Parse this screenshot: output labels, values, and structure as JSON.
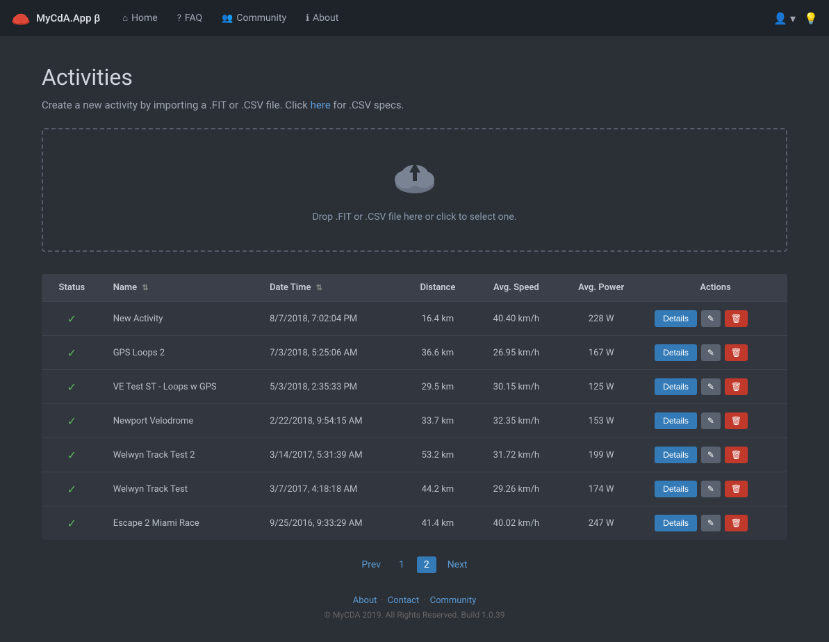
{
  "brand": {
    "name": "MyCdA.App β",
    "beta": "beta"
  },
  "nav": {
    "home": "Home",
    "faq": "FAQ",
    "community": "Community",
    "about": "About"
  },
  "page": {
    "title": "Activities",
    "subtitle_pre": "Create a new activity by importing a .FIT or .CSV file. Click",
    "subtitle_link": "here",
    "subtitle_post": "for .CSV specs."
  },
  "upload": {
    "prompt": "Drop .FIT or .CSV file here or click to select one."
  },
  "table": {
    "headers": [
      "Status",
      "Name",
      "Date Time",
      "Distance",
      "Avg. Speed",
      "Avg. Power",
      "Actions"
    ],
    "rows": [
      {
        "status": "✓",
        "name": "New Activity",
        "datetime": "8/7/2018, 7:02:04 PM",
        "distance": "16.4 km",
        "avg_speed": "40.40 km/h",
        "avg_power": "228 W"
      },
      {
        "status": "✓",
        "name": "GPS Loops 2",
        "datetime": "7/3/2018, 5:25:06 AM",
        "distance": "36.6 km",
        "avg_speed": "26.95 km/h",
        "avg_power": "167 W"
      },
      {
        "status": "✓",
        "name": "VE Test ST - Loops w GPS",
        "datetime": "5/3/2018, 2:35:33 PM",
        "distance": "29.5 km",
        "avg_speed": "30.15 km/h",
        "avg_power": "125 W"
      },
      {
        "status": "✓",
        "name": "Newport Velodrome",
        "datetime": "2/22/2018, 9:54:15 AM",
        "distance": "33.7 km",
        "avg_speed": "32.35 km/h",
        "avg_power": "153 W"
      },
      {
        "status": "✓",
        "name": "Welwyn Track Test 2",
        "datetime": "3/14/2017, 5:31:39 AM",
        "distance": "53.2 km",
        "avg_speed": "31.72 km/h",
        "avg_power": "199 W"
      },
      {
        "status": "✓",
        "name": "Welwyn Track Test",
        "datetime": "3/7/2017, 4:18:18 AM",
        "distance": "44.2 km",
        "avg_speed": "29.26 km/h",
        "avg_power": "174 W"
      },
      {
        "status": "✓",
        "name": "Escape 2 Miami Race",
        "datetime": "9/25/2016, 9:33:29 AM",
        "distance": "41.4 km",
        "avg_speed": "40.02 km/h",
        "avg_power": "247 W"
      }
    ],
    "btn_details": "Details",
    "btn_edit_icon": "✎",
    "btn_delete_icon": "🗑"
  },
  "pagination": {
    "prev": "Prev",
    "next": "Next",
    "pages": [
      "1",
      "2"
    ],
    "active": "2"
  },
  "footer": {
    "about": "About",
    "contact": "Contact",
    "community": "Community",
    "copyright": "© MyCDA 2019. All Rights Reserved. Build 1.0.39"
  }
}
